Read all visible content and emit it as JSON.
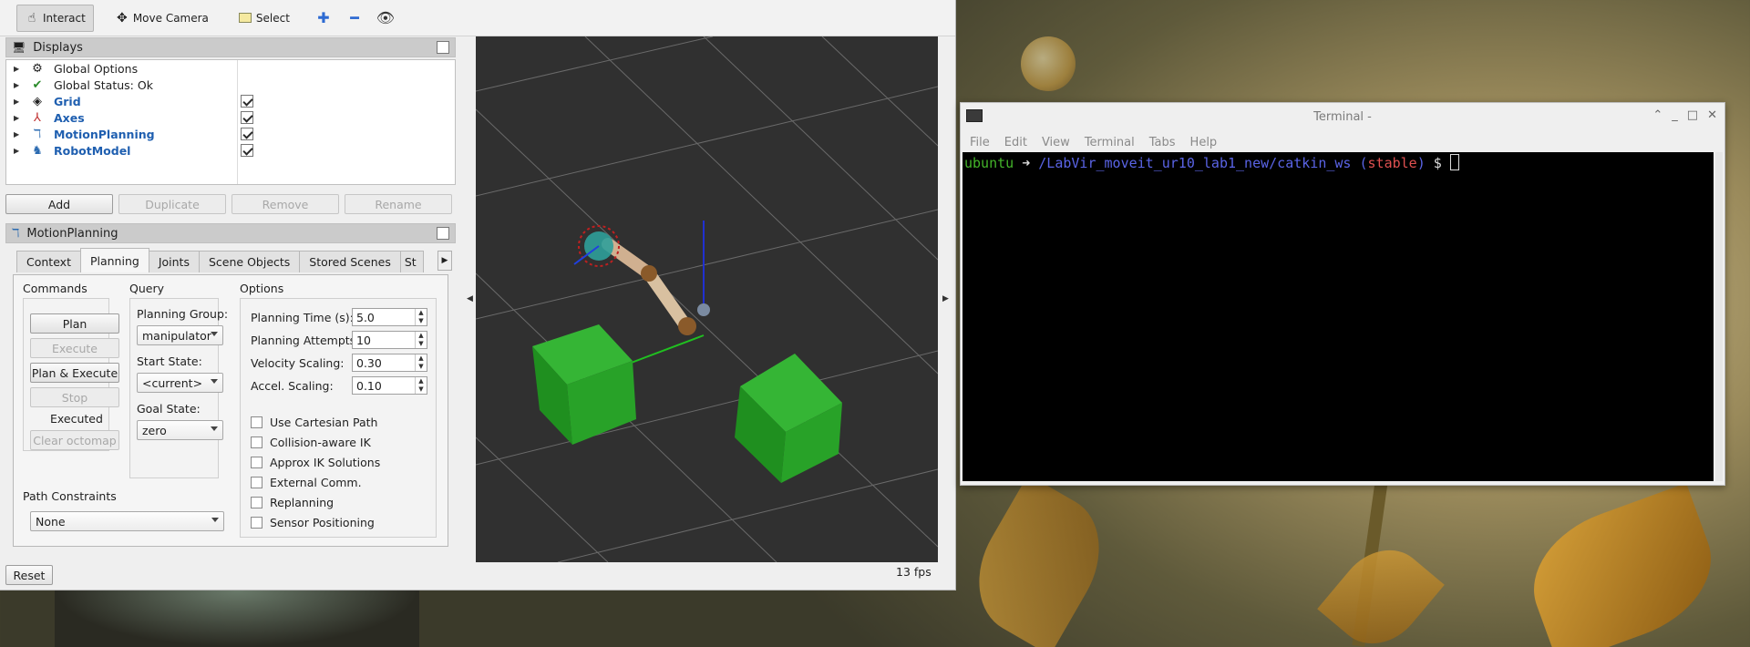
{
  "toolbar": {
    "interact": "Interact",
    "move_camera": "Move Camera",
    "select": "Select"
  },
  "displays": {
    "title": "Displays",
    "items": [
      {
        "label": "Global Options",
        "icon": "gear-icon"
      },
      {
        "label": "Global Status: Ok",
        "icon": "check-icon"
      },
      {
        "label": "Grid",
        "icon": "grid-icon",
        "checked": true
      },
      {
        "label": "Axes",
        "icon": "axes-icon",
        "checked": true
      },
      {
        "label": "MotionPlanning",
        "icon": "motion-planning-icon",
        "checked": true
      },
      {
        "label": "RobotModel",
        "icon": "robot-icon",
        "checked": true
      }
    ],
    "buttons": {
      "add": "Add",
      "duplicate": "Duplicate",
      "remove": "Remove",
      "rename": "Rename"
    }
  },
  "motion_planning": {
    "title": "MotionPlanning",
    "tabs": [
      "Context",
      "Planning",
      "Joints",
      "Scene Objects",
      "Stored Scenes",
      "St"
    ],
    "active_tab": "Planning",
    "commands": {
      "title": "Commands",
      "plan": "Plan",
      "execute": "Execute",
      "plan_execute": "Plan & Execute",
      "stop": "Stop",
      "status": "Executed",
      "clear_octomap": "Clear octomap"
    },
    "query": {
      "title": "Query",
      "planning_group_label": "Planning Group:",
      "planning_group": "manipulator",
      "start_state_label": "Start State:",
      "start_state": "<current>",
      "goal_state_label": "Goal State:",
      "goal_state": "zero"
    },
    "options": {
      "title": "Options",
      "planning_time_label": "Planning Time (s):",
      "planning_time": "5.0",
      "planning_attempts_label": "Planning Attempts:",
      "planning_attempts": "10",
      "velocity_scaling_label": "Velocity Scaling:",
      "velocity_scaling": "0.30",
      "accel_scaling_label": "Accel. Scaling:",
      "accel_scaling": "0.10",
      "checkboxes": [
        "Use Cartesian Path",
        "Collision-aware IK",
        "Approx IK Solutions",
        "External Comm.",
        "Replanning",
        "Sensor Positioning"
      ]
    },
    "path_constraints_label": "Path Constraints",
    "path_constraints": "None"
  },
  "footer": {
    "reset": "Reset",
    "fps": "13 fps"
  },
  "terminal": {
    "title": "Terminal -",
    "menu": [
      "File",
      "Edit",
      "View",
      "Terminal",
      "Tabs",
      "Help"
    ],
    "prompt_user": "ubuntu",
    "prompt_arrow": " ➜ ",
    "prompt_path": "/LabVir_moveit_ur10_lab1_new/catkin_ws",
    "prompt_branch_open": " (",
    "prompt_branch": "stable",
    "prompt_branch_close": ")",
    "prompt_symbol": " $ "
  },
  "colors": {
    "prompt_user": "#44b52a",
    "prompt_path": "#5a64e6",
    "prompt_branch": "#e05050",
    "display_label_blue": "#1f5fb0",
    "grid_green_box": "#2a9a2a"
  }
}
